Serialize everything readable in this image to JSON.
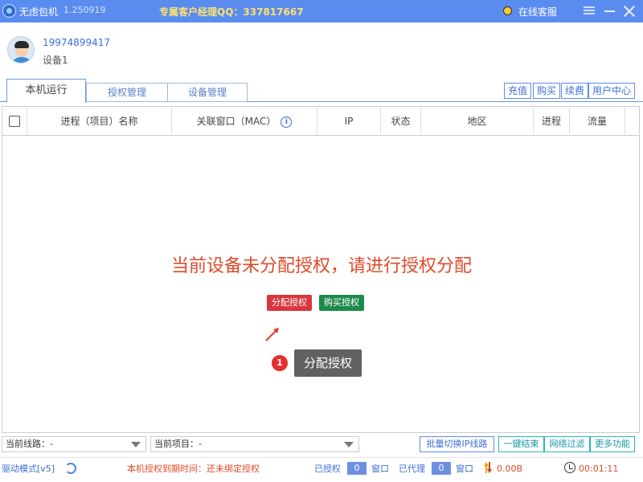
{
  "titlebar": {
    "app_name": "无虑包机",
    "version": "1.250919",
    "manager": "专属客户经理QQ：337817667",
    "online_service": "在线客服"
  },
  "user": {
    "phone": "19974899417",
    "device": "设备1"
  },
  "tabs": [
    {
      "label": "本机运行",
      "active": true
    },
    {
      "label": "授权管理",
      "active": false
    },
    {
      "label": "设备管理",
      "active": false
    }
  ],
  "actions": {
    "recharge": "充值",
    "buy": "购买",
    "renew": "续费",
    "user_center": "用户中心"
  },
  "table": {
    "columns": [
      "进程（项目）名称",
      "关联窗口（MAC）",
      "IP",
      "状态",
      "地区",
      "进程",
      "流量"
    ],
    "rows": []
  },
  "empty_state": {
    "message": "当前设备未分配授权，请进行授权分配",
    "assign_button": "分配授权",
    "buy_button": "购买授权",
    "tip_number": "1",
    "tip_text": "分配授权"
  },
  "bottom": {
    "route_label": "当前线路：-",
    "project_label": "当前项目：-",
    "batch_switch": "批量切换IP线路",
    "one_click_end": "一键结束",
    "net_filter": "网络过滤",
    "more": "更多功能"
  },
  "status": {
    "driver_mode": "驱动模式[v5]",
    "expire_text": "本机授权到期时间：还未绑定授权",
    "authorized_label": "已授权",
    "authorized_count": "0",
    "window_label": "窗口",
    "proxied_label": "已代理",
    "proxied_count": "0",
    "window_label2": "窗口",
    "traffic": "0.00B",
    "timer": "00:01:11"
  },
  "colors": {
    "titlebar": "#5a8cf0",
    "accent": "#3e6fd6",
    "error_text": "#e04a2a",
    "assign_btn": "#d9363e",
    "buy_btn": "#1e8a4c"
  }
}
